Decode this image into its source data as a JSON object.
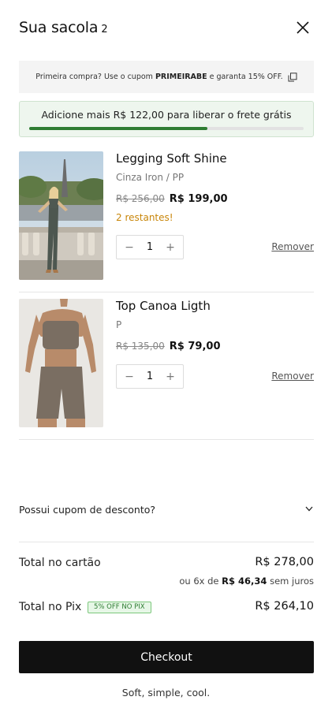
{
  "header": {
    "title": "Sua sacola",
    "count": "2"
  },
  "coupon_banner": {
    "prefix": "Primeira compra? Use o cupom",
    "code": "PRIMEIRABE",
    "suffix": "e garanta 15% OFF."
  },
  "shipping": {
    "message": "Adicione mais R$ 122,00 para liberar o frete grátis",
    "progress": 0.65,
    "progress_color": "#2e7d32"
  },
  "items": [
    {
      "name": "Legging Soft Shine",
      "variant": "Cinza Iron / PP",
      "old_price": "R$ 256,00",
      "price": "R$ 199,00",
      "stock": "2 restantes!",
      "quantity": "1",
      "remove_label": "Remover"
    },
    {
      "name": "Top Canoa Ligth",
      "variant": "P",
      "old_price": "R$ 135,00",
      "price": "R$ 79,00",
      "quantity": "1",
      "remove_label": "Remover"
    }
  ],
  "coupon_toggle": {
    "label": "Possui cupom de desconto?"
  },
  "totals": {
    "card_label": "Total no cartão",
    "card_value": "R$ 278,00",
    "installments_prefix": "ou 6x de",
    "installments_value": "R$ 46,34",
    "installments_suffix": "sem juros",
    "pix_label": "Total no Pix",
    "pix_badge": "5% OFF NO PIX",
    "pix_value": "R$ 264,10"
  },
  "checkout": {
    "label": "Checkout"
  },
  "footer": {
    "tagline": "Soft, simple, cool."
  }
}
